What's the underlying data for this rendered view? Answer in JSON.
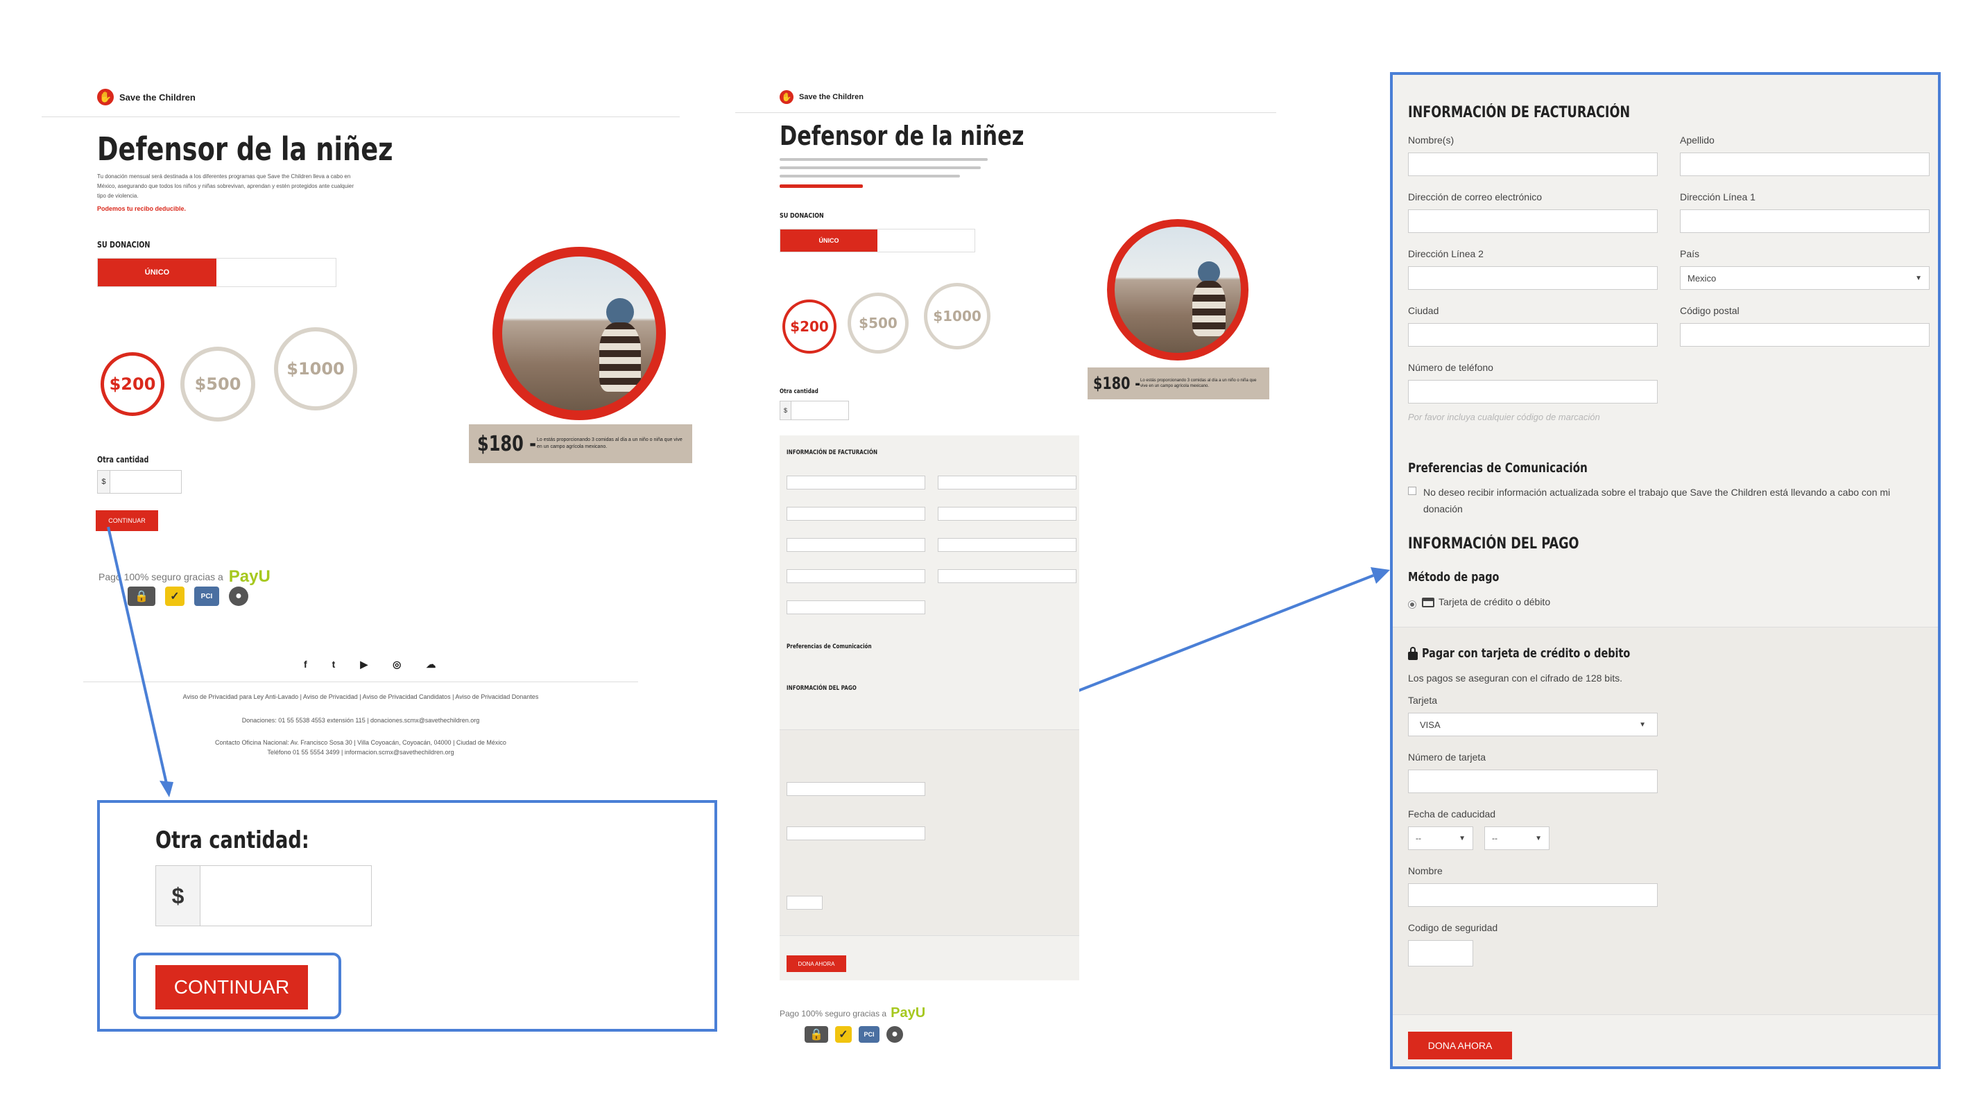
{
  "brand": "Save the Children",
  "page": {
    "title": "Defensor de la niñez",
    "desc": "Tu donación mensual será destinada a los diferentes programas que Save the Children lleva a cabo en México, asegurando que todos los niños y niñas sobrevivan, aprendan y estén protegidos ante cualquier tipo de violencia.",
    "deductible": "Podemos tu recibo deducible.",
    "donation_heading": "SU DONACION",
    "freq_selected": "ÚNICO",
    "amounts": [
      "$200",
      "$500",
      "$1000"
    ],
    "other_label": "Otra cantidad",
    "currency": "$",
    "continue": "CONTINUAR",
    "caption_price": "$180 -",
    "caption_text": "Lo estás proporcionando 3 comidas al día a un niño o niña que vive en un campo agrícola mexicano.",
    "secure": "Pago 100% seguro gracias a",
    "payu": "PayU",
    "social": [
      "f",
      "t",
      "▶",
      "◎",
      "☁"
    ],
    "footer_links": "Aviso de Privacidad para Ley Anti-Lavado | Aviso de Privacidad | Aviso de Privacidad Candidatos | Aviso de Privacidad Donantes",
    "footer_donations": "Donaciones: 01 55 5538 4553 extensión 115 | donaciones.scmx@savethechildren.org",
    "footer_contact1": "Contacto Oficina Nacional: Av. Francisco Sosa 30 | Villa Coyoacán, Coyoacán, 04000 | Ciudad de México",
    "footer_contact2": "Teléfono 01 55 5554 3499 | informacion.scmx@savethechildren.org"
  },
  "zoom1": {
    "label": "Otra cantidad:",
    "currency": "$",
    "button": "CONTINUAR"
  },
  "form": {
    "billing_title": "INFORMACIÓN DE FACTURACIÓN",
    "first_name": "Nombre(s)",
    "last_name": "Apellido",
    "email": "Dirección de correo electrónico",
    "address1": "Dirección Línea 1",
    "address2": "Dirección Línea 2",
    "country": "País",
    "country_value": "Mexico",
    "city": "Ciudad",
    "postal": "Código postal",
    "phone": "Número de teléfono",
    "phone_hint": "Por favor incluya cualquier código de marcación",
    "comm_title": "Preferencias de Comunicación",
    "comm_opt": "No deseo recibir información actualizada sobre el trabajo que Save the Children está llevando a cabo con mi donación",
    "payment_title": "INFORMACIÓN DEL PAGO",
    "method_title": "Método de pago",
    "method_opt": "Tarjeta de crédito o débito",
    "card_title": "Pagar con tarjeta de crédito o debito",
    "card_note": "Los pagos se aseguran con el cifrado de 128 bits.",
    "card_type": "Tarjeta",
    "card_type_value": "VISA",
    "card_number": "Número de tarjeta",
    "expiry": "Fecha de caducidad",
    "expiry_value": "--",
    "name": "Nombre",
    "cvv": "Codigo de seguridad",
    "donate": "DONA AHORA"
  },
  "colors": {
    "accent": "#da291c",
    "highlight": "#4a7fd6",
    "panel": "#f2f1ee"
  }
}
